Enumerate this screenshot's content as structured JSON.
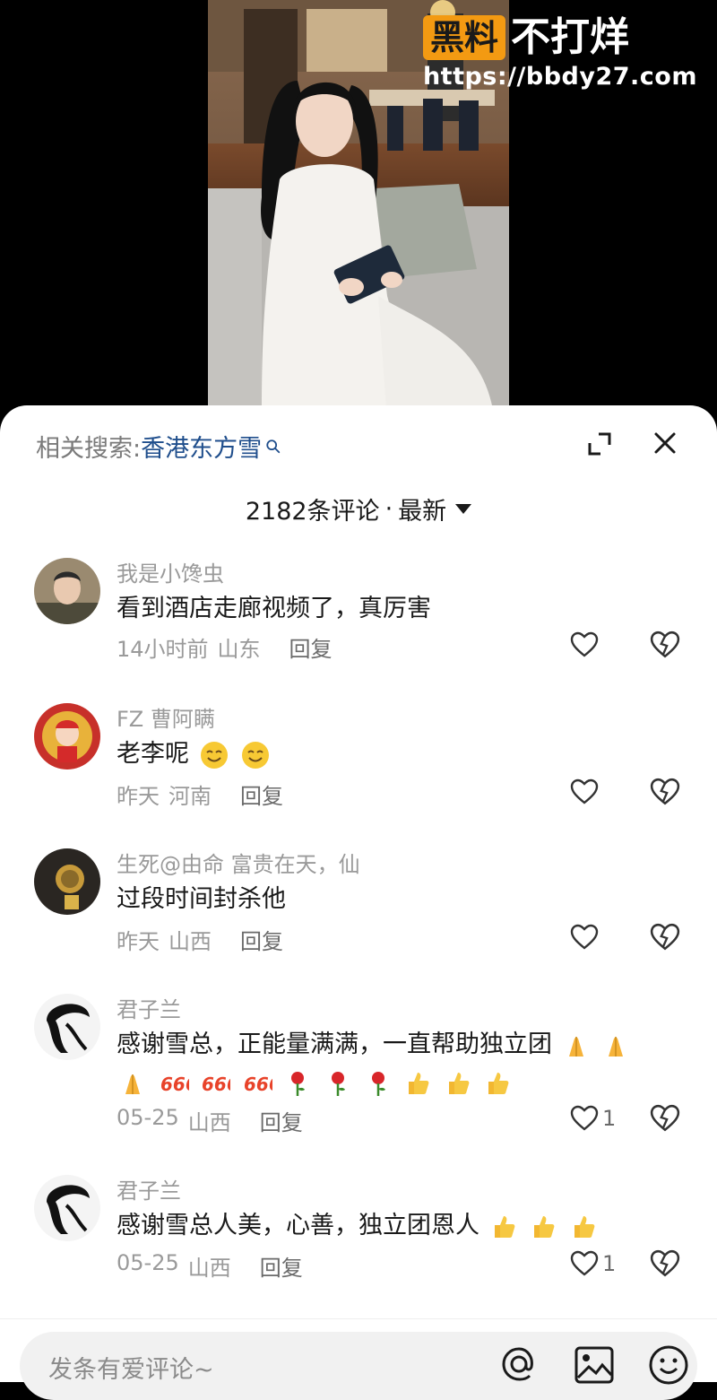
{
  "watermark": {
    "badge": "黑料",
    "text": "不打烊",
    "url": "https://bbdy27.com"
  },
  "related_search": {
    "label": "相关搜索:",
    "keyword": "香港东方雪"
  },
  "comment_count": {
    "count": "2182条评论",
    "separator": "·",
    "sort": "最新"
  },
  "comments": [
    {
      "name": "我是小馋虫",
      "text": "看到酒店走廊视频了，真厉害",
      "time": "14小时前",
      "region": "山东",
      "reply": "回复",
      "likes": ""
    },
    {
      "name": "FZ 曹阿瞒",
      "text": "老李呢",
      "time": "昨天",
      "region": "河南",
      "reply": "回复",
      "likes": ""
    },
    {
      "name": "生死@由命 富贵在天，仙",
      "text": "过段时间封杀他",
      "time": "昨天",
      "region": "山西",
      "reply": "回复",
      "likes": ""
    },
    {
      "name": "君子兰",
      "text": "感谢雪总，正能量满满，一直帮助独立团",
      "time": "05-25",
      "region": "山西",
      "reply": "回复",
      "likes": "1"
    },
    {
      "name": "君子兰",
      "text": "感谢雪总人美，心善，独立团恩人",
      "time": "05-25",
      "region": "山西",
      "reply": "回复",
      "likes": "1"
    }
  ],
  "input": {
    "placeholder": "发条有爱评论~"
  },
  "colors": {
    "link": "#1f4e8c",
    "badge": "#f39a12",
    "muted": "#9a9a9a"
  }
}
